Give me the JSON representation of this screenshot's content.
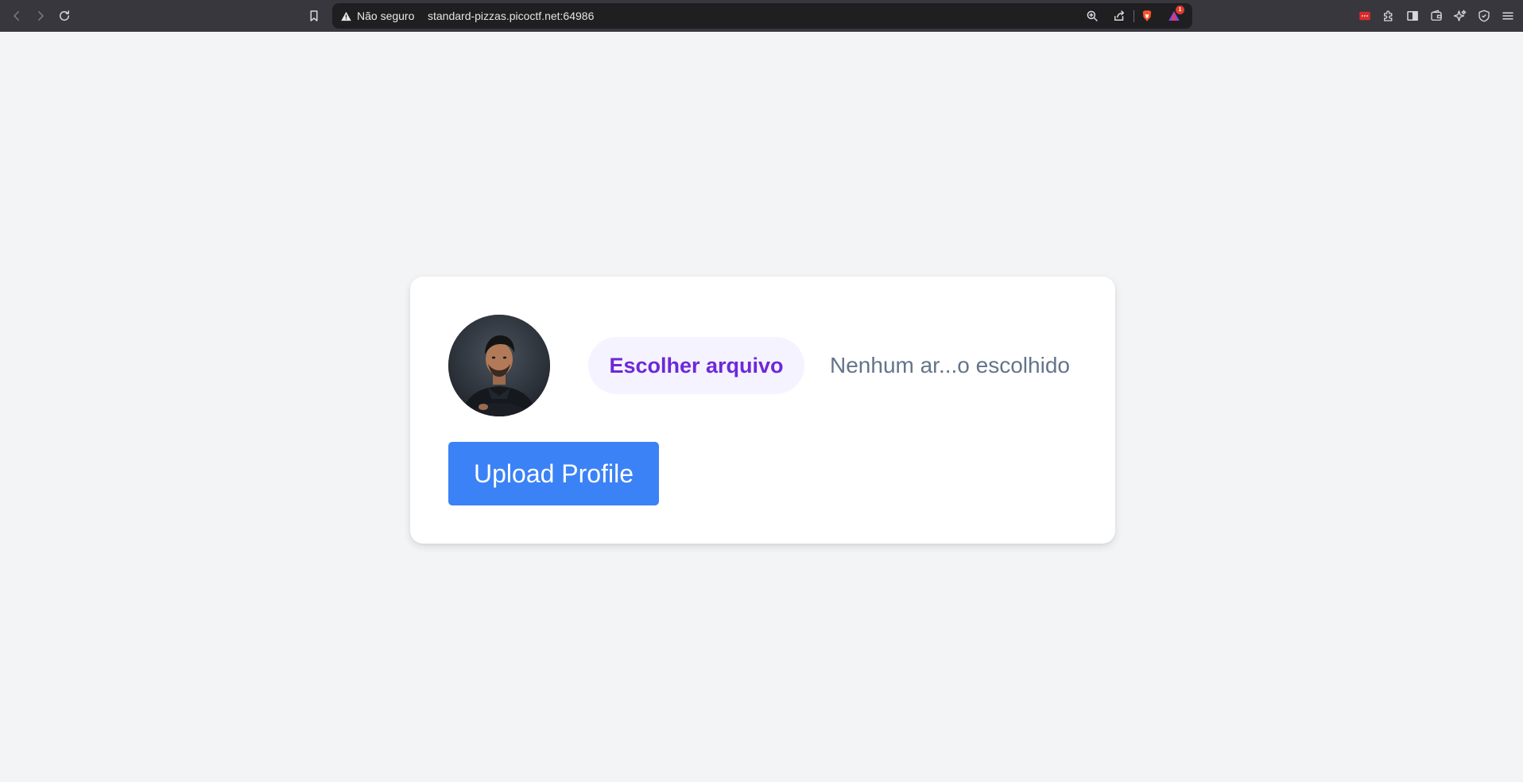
{
  "browser": {
    "security_label": "Não seguro",
    "url": "standard-pizzas.picoctf.net:64986",
    "notification_count": "1",
    "icons": {
      "back": "chevron-left-icon",
      "forward": "chevron-right-icon",
      "reload": "reload-icon",
      "bookmark": "bookmark-icon",
      "warning": "warning-triangle-icon",
      "zoom": "zoom-icon",
      "share": "share-icon",
      "brave_shields": "brave-lion-icon",
      "brave_rewards": "triangle-rewards-icon",
      "extension": "extension-icon",
      "puzzle": "puzzle-icon",
      "sidebar": "sidebar-icon",
      "wallet": "wallet-icon",
      "leo": "sparkle-icon",
      "vpn": "shield-icon",
      "menu": "hamburger-menu-icon"
    },
    "colors": {
      "chrome_bg": "#37373d",
      "urlbar_bg": "#1f1f22",
      "brave_orange": "#fb542b",
      "extension_red": "#d92b2b"
    }
  },
  "page": {
    "background": "#f3f4f6",
    "card": {
      "avatar_alt": "profile photo",
      "file_input": {
        "button_label": "Escolher arquivo",
        "status_text": "Nenhum ar...o escolhido"
      },
      "upload_button_label": "Upload Profile"
    },
    "colors": {
      "file_button_bg": "#f5f3ff",
      "file_button_text": "#6d28d9",
      "status_text": "#64748b",
      "upload_bg": "#3b82f6",
      "upload_text": "#ffffff"
    }
  }
}
